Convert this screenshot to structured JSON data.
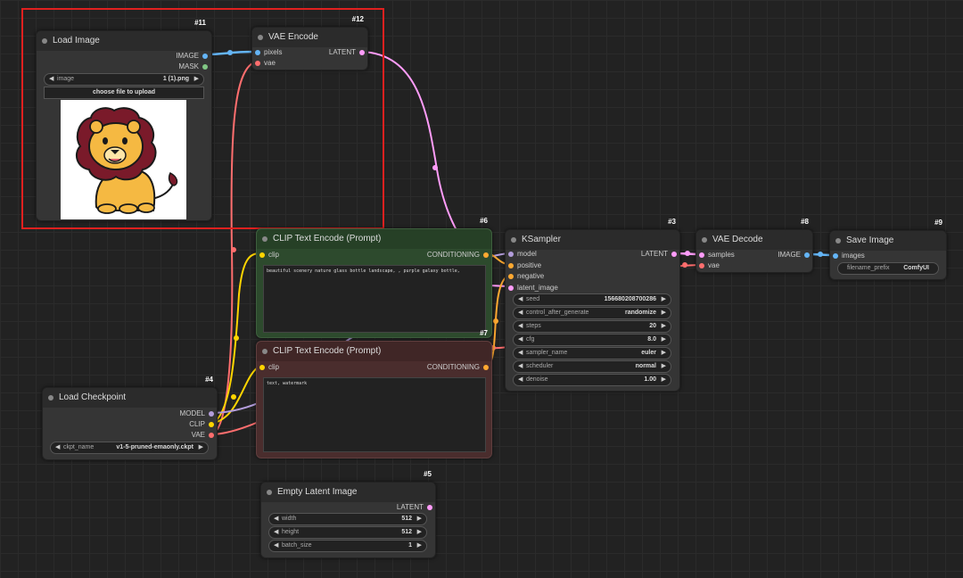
{
  "nodes": {
    "load_image": {
      "id": "#11",
      "title": "Load Image",
      "outputs": [
        "IMAGE",
        "MASK"
      ],
      "image_widget_label": "image",
      "image_widget_value": "1 (1).png",
      "upload_label": "choose file to upload"
    },
    "vae_encode": {
      "id": "#12",
      "title": "VAE Encode",
      "inputs": [
        "pixels",
        "vae"
      ],
      "output": "LATENT"
    },
    "clip_pos": {
      "id": "#6",
      "title": "CLIP Text Encode (Prompt)",
      "input": "clip",
      "output": "CONDITIONING",
      "text": "beautiful scenery nature glass bottle landscape, , purple galaxy bottle,"
    },
    "clip_neg": {
      "id": "#7",
      "title": "CLIP Text Encode (Prompt)",
      "input": "clip",
      "output": "CONDITIONING",
      "text": "text, watermark"
    },
    "ksampler": {
      "id": "#3",
      "title": "KSampler",
      "inputs": [
        "model",
        "positive",
        "negative",
        "latent_image"
      ],
      "output": "LATENT",
      "widgets": [
        {
          "label": "seed",
          "value": "156680208700286"
        },
        {
          "label": "control_after_generate",
          "value": "randomize"
        },
        {
          "label": "steps",
          "value": "20"
        },
        {
          "label": "cfg",
          "value": "8.0"
        },
        {
          "label": "sampler_name",
          "value": "euler"
        },
        {
          "label": "scheduler",
          "value": "normal"
        },
        {
          "label": "denoise",
          "value": "1.00"
        }
      ]
    },
    "vae_decode": {
      "id": "#8",
      "title": "VAE Decode",
      "inputs": [
        "samples",
        "vae"
      ],
      "output": "IMAGE"
    },
    "save_image": {
      "id": "#9",
      "title": "Save Image",
      "input": "images",
      "prefix_label": "filename_prefix",
      "prefix_value": "ComfyUI"
    },
    "load_checkpoint": {
      "id": "#4",
      "title": "Load Checkpoint",
      "outputs": [
        "MODEL",
        "CLIP",
        "VAE"
      ],
      "ckpt_label": "ckpt_name",
      "ckpt_value": "v1-5-pruned-emaonly.ckpt"
    },
    "empty_latent": {
      "id": "#5",
      "title": "Empty Latent Image",
      "output": "LATENT",
      "widgets": [
        {
          "label": "width",
          "value": "512"
        },
        {
          "label": "height",
          "value": "512"
        },
        {
          "label": "batch_size",
          "value": "1"
        }
      ]
    }
  },
  "colors": {
    "image": "#64b5f6",
    "mask": "#81c784",
    "latent": "#ff9cf9",
    "vae": "#ff6e6e",
    "clip": "#ffd500",
    "conditioning": "#ffa931",
    "model": "#b39ddb",
    "selection": "#e0201f",
    "clip_pos_bg": "#2d4a2d",
    "clip_neg_bg": "#4a2d2d"
  }
}
